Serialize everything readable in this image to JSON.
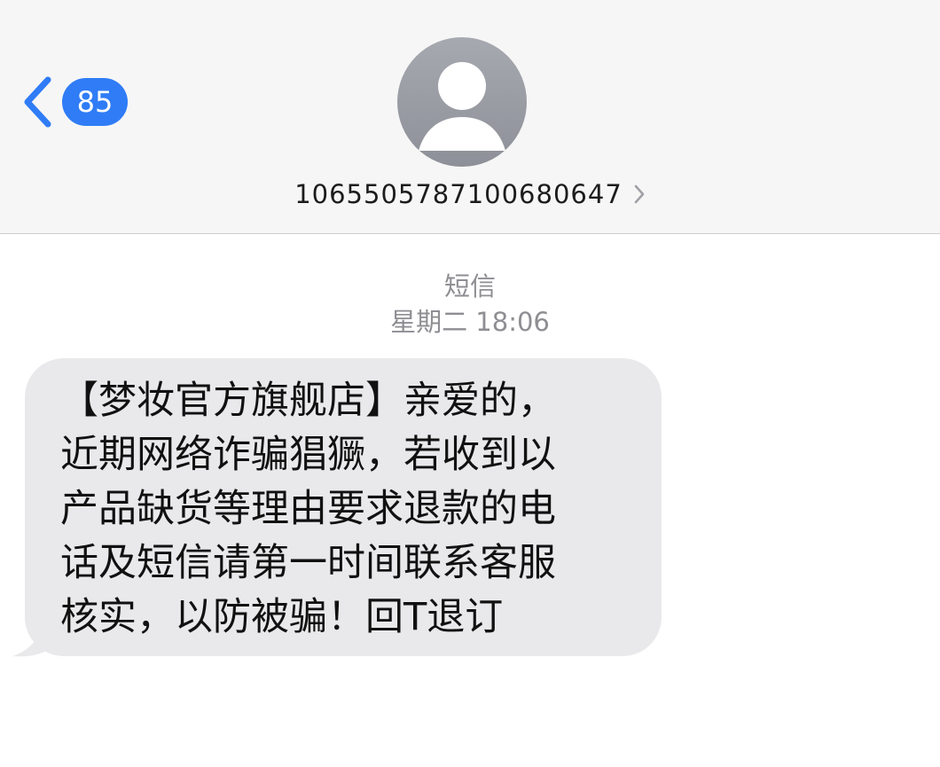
{
  "header": {
    "back_icon": "chevron-left-icon",
    "unread_count": "85",
    "avatar_icon": "person-silhouette-icon",
    "contact_name": "10655057871006806​47",
    "contact_chevron_icon": "chevron-right-icon"
  },
  "conversation": {
    "service_type": "短信",
    "timestamp": "星期二 18:06"
  },
  "message": {
    "text": "【梦妆官方旗舰店】亲爱的，\n近期网络诈骗猖獗，若收到以\n产品缺货等理由要求退款的电\n话及短信请第一时间联系客服\n核实，以防被骗！回T退订"
  },
  "colors": {
    "accent": "#2f7cf6",
    "header_bg": "#f6f6f6",
    "bubble_bg": "#e9e9eb",
    "meta_text": "#8e8e93"
  }
}
